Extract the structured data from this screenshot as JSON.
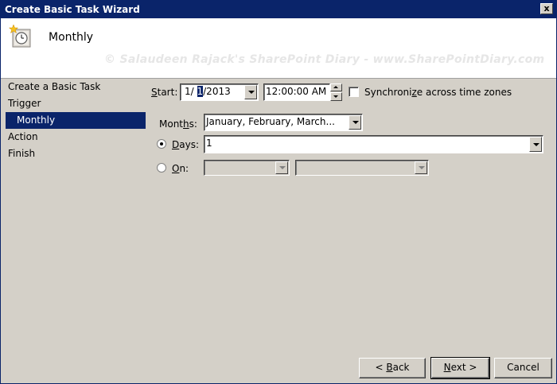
{
  "window": {
    "title": "Create Basic Task Wizard",
    "close_glyph": "x"
  },
  "header": {
    "heading": "Monthly",
    "watermark": "© Salaudeen Rajack's SharePoint Diary - www.SharePointDiary.com",
    "icon": "clock-icon"
  },
  "nav": {
    "items": [
      {
        "label": "Create a Basic Task"
      },
      {
        "label": "Trigger"
      },
      {
        "label": "Monthly"
      },
      {
        "label": "Action"
      },
      {
        "label": "Finish"
      }
    ]
  },
  "form": {
    "start": {
      "label_pre": "",
      "label_ul": "S",
      "label_post": "tart:",
      "date_pre": "1/ ",
      "date_sel": "1",
      "date_post": "/2013",
      "time": "12:00:00 AM"
    },
    "sync": {
      "label_pre": "Synchroni",
      "label_ul": "z",
      "label_post": "e across time zones",
      "checked": false
    },
    "months": {
      "label_pre": "Mont",
      "label_ul": "h",
      "label_post": "s:",
      "value": "January, February, March..."
    },
    "days": {
      "label_pre": "",
      "label_ul": "D",
      "label_post": "ays:",
      "value": "1",
      "selected": true
    },
    "on": {
      "label_pre": "",
      "label_ul": "O",
      "label_post": "n:",
      "selected": false
    }
  },
  "buttons": {
    "back": {
      "pre": "< ",
      "ul": "B",
      "post": "ack"
    },
    "next": {
      "pre": "",
      "ul": "N",
      "post": "ext >"
    },
    "cancel": {
      "label": "Cancel"
    }
  }
}
